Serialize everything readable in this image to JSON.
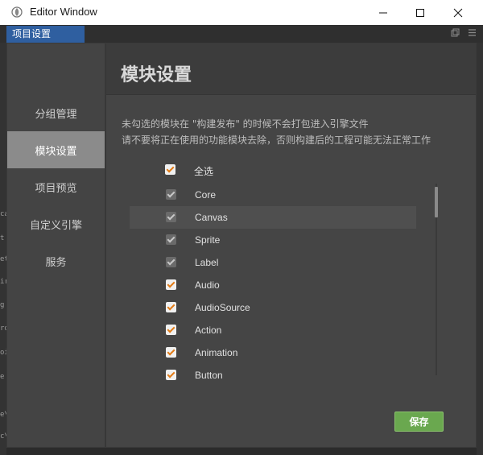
{
  "window": {
    "title": "Editor Window",
    "icon": "app-logo-icon"
  },
  "tab": {
    "label": "项目设置"
  },
  "background_code": [
    "ca",
    "t",
    "et",
    "ir",
    "g",
    "ro",
    "oi",
    "e",
    "e\\",
    "c\\"
  ],
  "sidebar": {
    "items": [
      {
        "label": "分组管理",
        "active": false
      },
      {
        "label": "模块设置",
        "active": true
      },
      {
        "label": "项目预览",
        "active": false
      },
      {
        "label": "自定义引擎",
        "active": false
      },
      {
        "label": "服务",
        "active": false
      }
    ]
  },
  "content": {
    "title": "模块设置",
    "description_lines": [
      "未勾选的模块在 \"构建发布\" 的时候不会打包进入引擎文件",
      "请不要将正在使用的功能模块去除，否则构建后的工程可能无法正常工作"
    ],
    "select_all": {
      "label": "全选",
      "checked": true
    },
    "modules": [
      {
        "label": "Core",
        "checked": true,
        "disabled": true
      },
      {
        "label": "Canvas",
        "checked": true,
        "disabled": true
      },
      {
        "label": "Sprite",
        "checked": true,
        "disabled": true
      },
      {
        "label": "Label",
        "checked": true,
        "disabled": true
      },
      {
        "label": "Audio",
        "checked": true,
        "disabled": false
      },
      {
        "label": "AudioSource",
        "checked": true,
        "disabled": false
      },
      {
        "label": "Action",
        "checked": true,
        "disabled": false
      },
      {
        "label": "Animation",
        "checked": true,
        "disabled": false
      },
      {
        "label": "Button",
        "checked": true,
        "disabled": false
      }
    ],
    "save_label": "保存"
  },
  "colors": {
    "accent_check": "#e27b15",
    "tab_active": "#2f5fa0",
    "save_button": "#6aa84f",
    "nav_active": "#8b8b8b"
  }
}
